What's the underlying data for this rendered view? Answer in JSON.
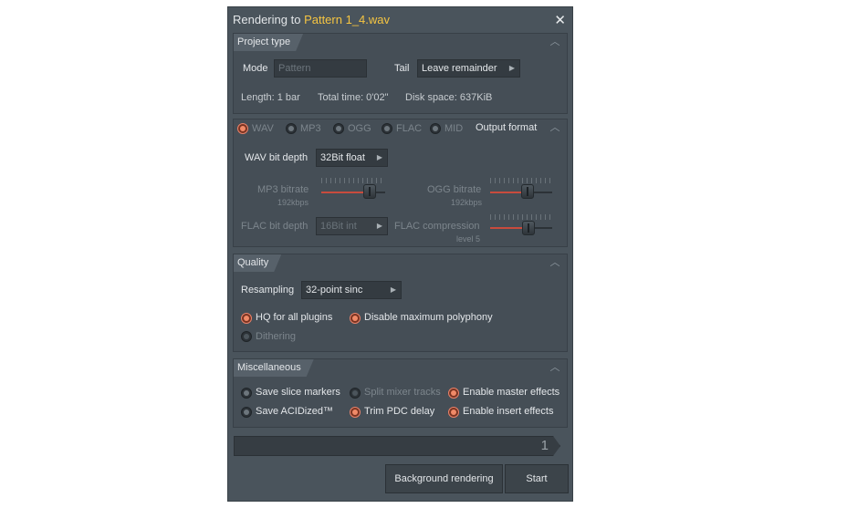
{
  "dialog": {
    "title_prefix": "Rendering to ",
    "title_file": "Pattern 1_4.wav",
    "close_symbol": "✕"
  },
  "project_type": {
    "tab": "Project type",
    "mode_label": "Mode",
    "mode_placeholder": "Pattern",
    "tail_label": "Tail",
    "tail_value": "Leave remainder",
    "length": "Length: 1 bar",
    "total_time": "Total time: 0'02\"",
    "disk_space": "Disk space: 637KiB"
  },
  "output_format": {
    "tab": "Output format",
    "formats": [
      {
        "label": "WAV",
        "selected": true
      },
      {
        "label": "MP3",
        "selected": false
      },
      {
        "label": "OGG",
        "selected": false
      },
      {
        "label": "FLAC",
        "selected": false
      },
      {
        "label": "MID",
        "selected": false
      }
    ],
    "wav_bit_depth_label": "WAV bit depth",
    "wav_bit_depth_value": "32Bit float",
    "mp3_bitrate_label": "MP3 bitrate",
    "mp3_bitrate_value": "192kbps",
    "ogg_bitrate_label": "OGG bitrate",
    "ogg_bitrate_value": "192kbps",
    "flac_bit_depth_label": "FLAC bit depth",
    "flac_bit_depth_value": "16Bit int",
    "flac_compression_label": "FLAC compression",
    "flac_compression_value": "level 5",
    "mp3_slider_fraction": 0.75,
    "ogg_slider_fraction": 0.6,
    "flac_slider_fraction": 0.62
  },
  "quality": {
    "tab": "Quality",
    "resampling_label": "Resampling",
    "resampling_value": "32-point sinc",
    "hq_plugins": "HQ for all plugins",
    "disable_polyphony": "Disable maximum polyphony",
    "dithering": "Dithering"
  },
  "misc": {
    "tab": "Miscellaneous",
    "save_slice_markers": "Save slice markers",
    "split_mixer_tracks": "Split mixer tracks",
    "enable_master_effects": "Enable master effects",
    "save_acidized": "Save ACIDized™",
    "trim_pdc_delay": "Trim PDC delay",
    "enable_insert_effects": "Enable insert effects"
  },
  "progress": {
    "value": "1"
  },
  "buttons": {
    "background_rendering": "Background rendering",
    "start": "Start"
  },
  "colors": {
    "accent_orange": "#f08a68",
    "title_file": "#f5c542",
    "panel": "#4a545c"
  }
}
